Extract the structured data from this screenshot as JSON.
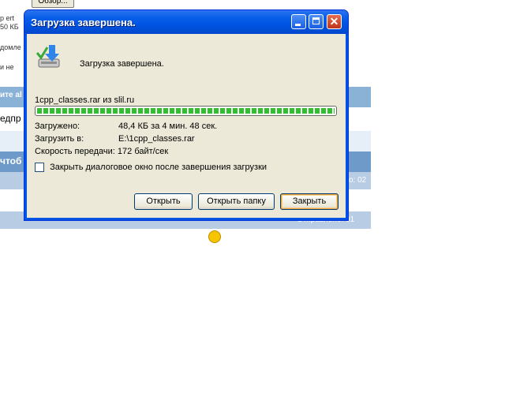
{
  "background": {
    "browse_button": "Обзор...",
    "fragments": [
      "p ert",
      "50 КБ",
      "домле",
      "и не",
      "ите al",
      "едпр",
      "чтоб"
    ],
    "sent_labels": [
      "о: 02",
      "Отправлено: 01"
    ]
  },
  "dialog": {
    "title": "Загрузка завершена.",
    "message": "Загрузка завершена.",
    "source": "1cpp_classes.rar из slil.ru",
    "progress_percent": 100,
    "downloaded_label": "Загружено:",
    "downloaded_value": "48,4 КБ за 4 мин. 48 сек.",
    "saved_to_label": "Загрузить в:",
    "saved_to_value": "E:\\1cpp_classes.rar",
    "speed_label": "Скорость передачи:",
    "speed_value": "172 байт/сек",
    "close_on_complete_label": "Закрыть диалоговое окно после завершения загрузки",
    "close_on_complete_checked": false,
    "buttons": {
      "open": "Открыть",
      "open_folder": "Открыть папку",
      "close": "Закрыть"
    }
  },
  "colors": {
    "titlebar": "#0054e3",
    "progress": "#2fbf2f",
    "close_button": "#c0341b"
  },
  "icons": [
    "minimize-icon",
    "maximize-icon",
    "close-icon",
    "download-complete-icon"
  ]
}
